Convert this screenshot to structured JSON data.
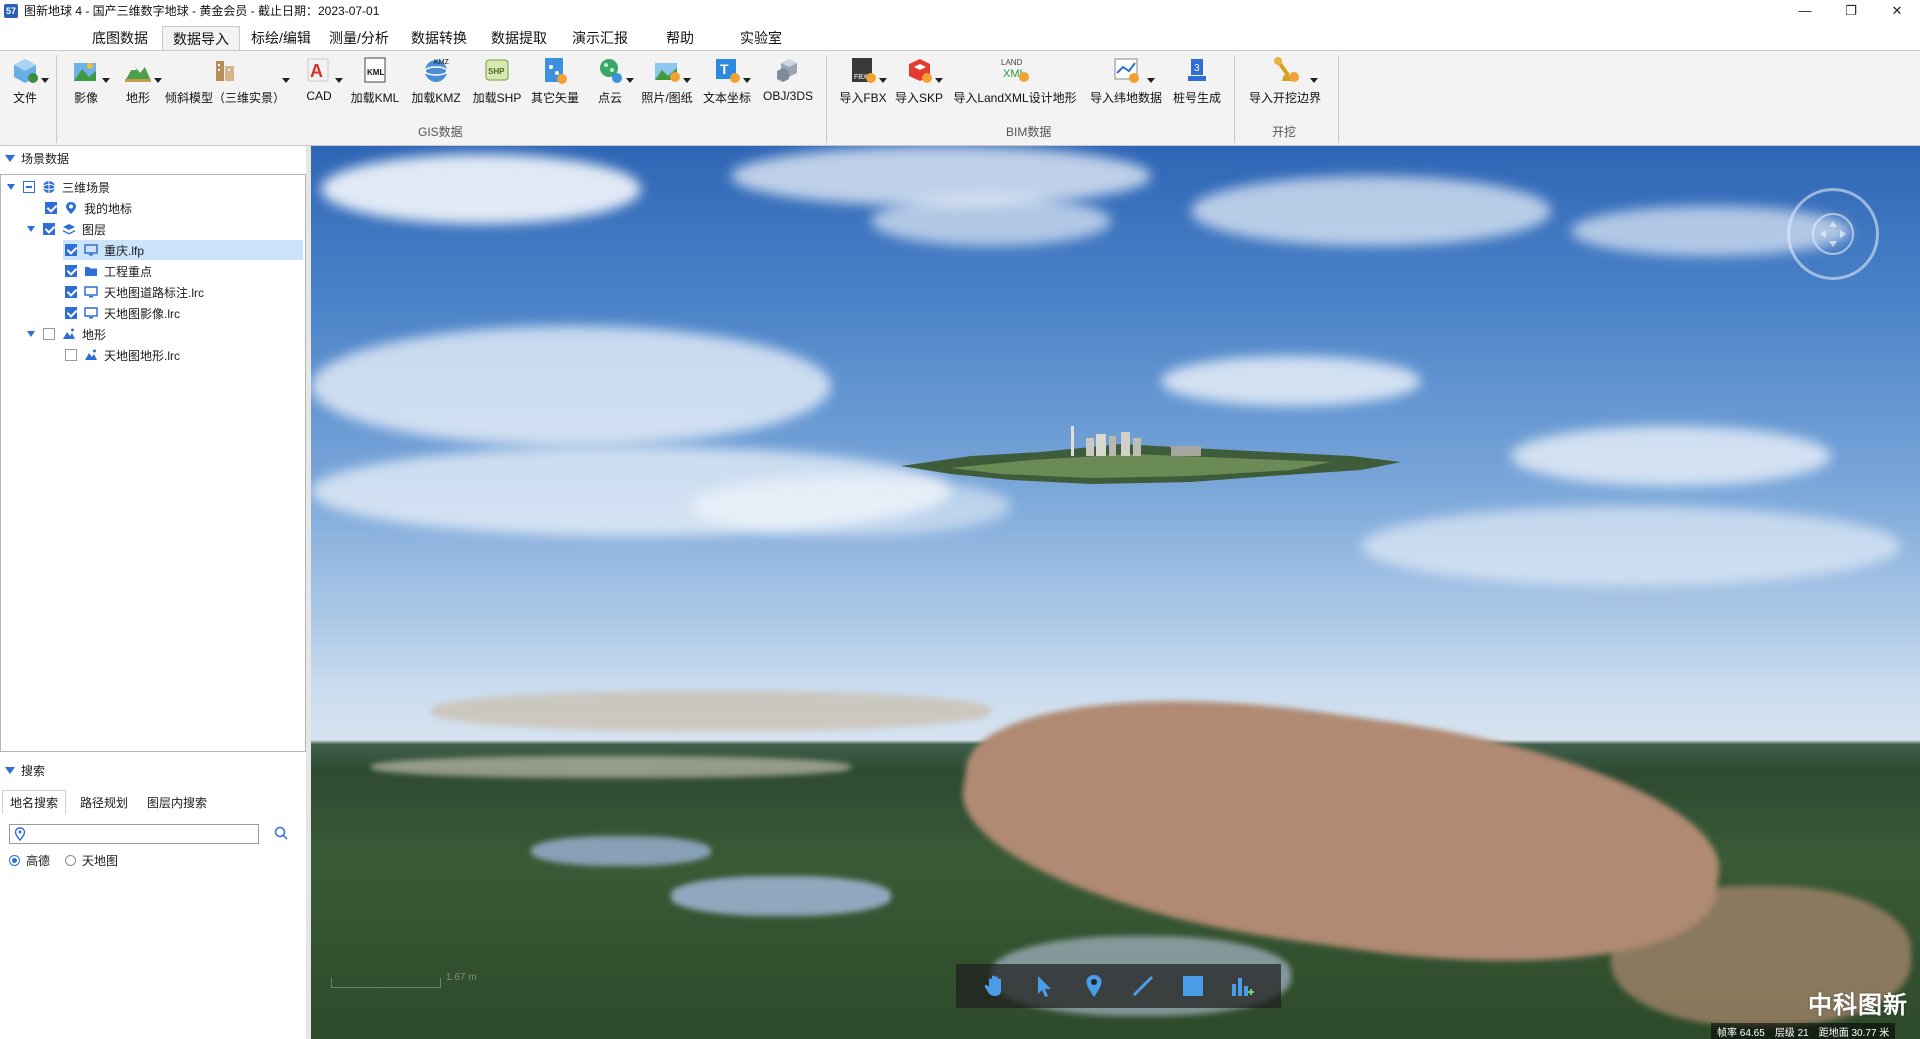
{
  "window": {
    "title": "图新地球 4 - 国产三维数字地球 - 黄金会员 - 截止日期：2023-07-01",
    "logo_text": "57",
    "minimize": "—",
    "maximize": "❐",
    "close": "✕"
  },
  "menu": {
    "tabs": [
      "底图数据",
      "数据导入",
      "标绘/编辑",
      "测量/分析",
      "数据转换",
      "数据提取",
      "演示汇报",
      "帮助",
      "实验室"
    ],
    "active": "数据导入"
  },
  "ribbon": {
    "file": "文件",
    "gis": [
      "影像",
      "地形",
      "倾斜模型（三维实景）",
      "CAD",
      "加载KML",
      "加载KMZ",
      "加载SHP",
      "其它矢量",
      "点云",
      "照片/图纸",
      "文本坐标",
      "OBJ/3DS"
    ],
    "bim": [
      "导入FBX",
      "导入SKP",
      "导入LandXML设计地形",
      "导入纬地数据",
      "桩号生成"
    ],
    "excav": [
      "导入开挖边界"
    ],
    "group_gis": "GIS数据",
    "group_bim": "BIM数据",
    "group_excav": "开挖",
    "icon_text": {
      "cad": "A",
      "kml": "KML",
      "kmz": "KMZ",
      "shp": "SHP",
      "fbx": "FBX",
      "landxml": "LAND XML",
      "stake": "3"
    }
  },
  "scene_panel": {
    "title": "场景数据",
    "tree": [
      {
        "label": "三维场景",
        "icon": "globe-icon",
        "check": "partial"
      },
      {
        "label": "我的地标",
        "icon": "pin-icon",
        "check": "checked"
      },
      {
        "label": "图层",
        "icon": "layers-icon",
        "check": "checked"
      },
      {
        "label": "重庆.lfp",
        "icon": "monitor-icon",
        "check": "checked",
        "selected": true
      },
      {
        "label": "工程重点",
        "icon": "folder-icon",
        "check": "checked"
      },
      {
        "label": "天地图道路标注.lrc",
        "icon": "monitor-icon",
        "check": "checked"
      },
      {
        "label": "天地图影像.lrc",
        "icon": "monitor-icon",
        "check": "checked"
      },
      {
        "label": "地形",
        "icon": "terrain-icon",
        "check": "empty"
      },
      {
        "label": "天地图地形.lrc",
        "icon": "terrain-icon",
        "check": "empty"
      }
    ]
  },
  "search_panel": {
    "title": "搜索",
    "tabs": [
      "地名搜索",
      "路径规划",
      "图层内搜索"
    ],
    "active_tab": "地名搜索",
    "input_value": "",
    "sources": [
      {
        "label": "高德",
        "selected": true
      },
      {
        "label": "天地图",
        "selected": false
      }
    ]
  },
  "view": {
    "watermark": "中科图新",
    "status": [
      "帧率 64.65",
      "层级 21",
      "距地面 30.77 米"
    ],
    "scale_label": "1.67 m"
  },
  "colors": {
    "accent": "#2d6fd6",
    "ribbon_bg": "#f3f3f3",
    "selected_row": "#cce4fb"
  }
}
